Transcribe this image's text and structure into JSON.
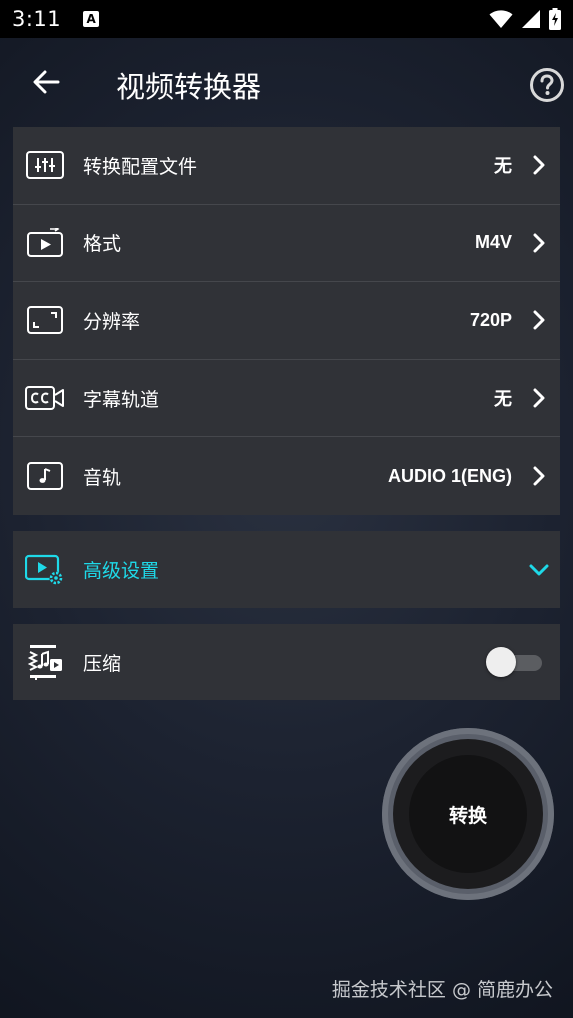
{
  "status_bar": {
    "time": "3:11",
    "notification_letter": "A"
  },
  "app_bar": {
    "title": "视频转换器"
  },
  "settings": [
    {
      "label": "转换配置文件",
      "value": "无",
      "icon": "sliders-icon"
    },
    {
      "label": "格式",
      "value": "M4V",
      "icon": "video-format-icon"
    },
    {
      "label": "分辨率",
      "value": "720P",
      "icon": "resolution-icon"
    },
    {
      "label": "字幕轨道",
      "value": "无",
      "icon": "subtitle-cc-icon"
    },
    {
      "label": "音轨",
      "value": "AUDIO 1(ENG)",
      "icon": "music-note-icon"
    }
  ],
  "advanced": {
    "label": "高级设置",
    "icon": "video-settings-icon",
    "accent": "#1ed9e8"
  },
  "compress": {
    "label": "压缩",
    "icon": "compress-icon",
    "enabled": false
  },
  "convert_button": {
    "label": "转换"
  },
  "watermark": "掘金技术社区 @ 简鹿办公"
}
